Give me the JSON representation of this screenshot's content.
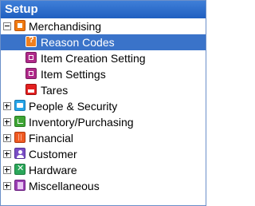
{
  "panel": {
    "title": "Setup"
  },
  "tree": {
    "merchandising": {
      "label": "Merchandising",
      "icon": "folder-icon",
      "expanded": true
    },
    "reason_codes": {
      "label": "Reason Codes",
      "icon": "reason-codes-icon",
      "selected": true
    },
    "item_creation_setting": {
      "label": "Item Creation Setting",
      "icon": "box-icon"
    },
    "item_settings": {
      "label": "Item Settings",
      "icon": "box-icon"
    },
    "tares": {
      "label": "Tares",
      "icon": "tares-icon"
    },
    "people_security": {
      "label": "People & Security",
      "icon": "people-icon",
      "expanded": false
    },
    "inventory_purchasing": {
      "label": "Inventory/Purchasing",
      "icon": "inventory-icon",
      "expanded": false
    },
    "financial": {
      "label": "Financial",
      "icon": "financial-icon",
      "expanded": false
    },
    "customer": {
      "label": "Customer",
      "icon": "customer-icon",
      "expanded": false
    },
    "hardware": {
      "label": "Hardware",
      "icon": "hardware-icon",
      "expanded": false
    },
    "miscellaneous": {
      "label": "Miscellaneous",
      "icon": "miscellaneous-icon",
      "expanded": false
    }
  },
  "colors": {
    "header_background": "#2a6bcb",
    "selection_background": "#3a73c9"
  }
}
